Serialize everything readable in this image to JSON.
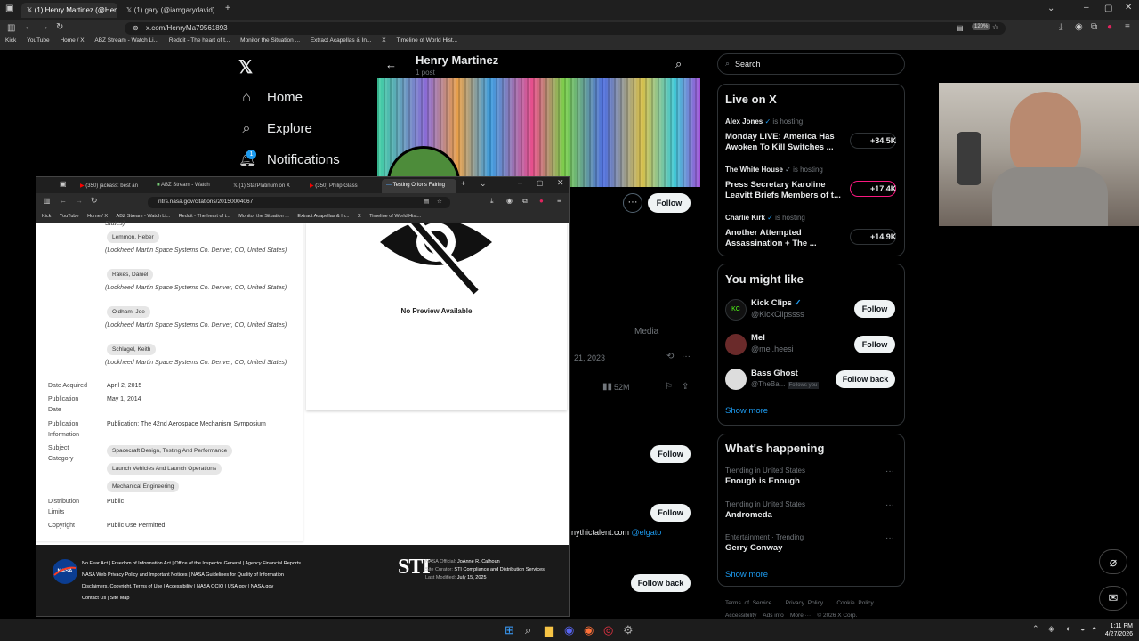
{
  "outer_tabs": [
    {
      "label": "(1) Henry Martinez (@HenryMa",
      "active": true
    },
    {
      "label": "(1) gary (@iamgarydavid) / X",
      "active": false
    }
  ],
  "outer_url": "x.com/HenryMa79561893",
  "outer_zoom": "120%",
  "outer_bookmarks": [
    "Kick",
    "YouTube",
    "Home / X",
    "ABZ Stream - Watch Li...",
    "Reddit - The heart of t...",
    "Monitor the Situation ...",
    "Extract Acapellas & In...",
    "X",
    "Timeline of World Hist..."
  ],
  "nav": {
    "home": "Home",
    "explore": "Explore",
    "notifications": "Notifications",
    "notif_badge": "1"
  },
  "profile": {
    "name": "Henry Martinez",
    "posts": "1 post",
    "follow": "Follow",
    "media_tab": "Media",
    "post_date": "21, 2023",
    "views": "52M",
    "follow2": "Follow",
    "follow3": "Follow",
    "follow_back": "Follow back",
    "link_text": "nythictalent.com",
    "mention": "@elgato"
  },
  "search": {
    "placeholder": "Search"
  },
  "live": {
    "title": "Live on X",
    "items": [
      {
        "host": "Alex Jones",
        "suffix": "is hosting",
        "title": "Monday LIVE: America Has Awoken To Kill Switches ...",
        "count": "+34.5K",
        "pink": false
      },
      {
        "host": "The White House",
        "suffix": "is hosting",
        "title": "Press Secretary Karoline Leavitt Briefs Members of t...",
        "count": "+17.4K",
        "pink": true
      },
      {
        "host": "Charlie Kirk",
        "suffix": "is hosting",
        "title": "Another Attempted Assassination + The ...",
        "count": "+14.9K",
        "pink": false
      }
    ]
  },
  "might_like": {
    "title": "You might like",
    "items": [
      {
        "name": "Kick Clips",
        "handle": "@KickClipssss",
        "btn": "Follow",
        "follows_you": ""
      },
      {
        "name": "Mel",
        "handle": "@mel.heesi",
        "btn": "Follow",
        "follows_you": ""
      },
      {
        "name": "Bass Ghost",
        "handle": "@TheBa...",
        "btn": "Follow back",
        "follows_you": "Follows you"
      }
    ],
    "show_more": "Show more"
  },
  "happening": {
    "title": "What's happening",
    "items": [
      {
        "meta": "Trending in United States",
        "name": "Enough is Enough"
      },
      {
        "meta": "Trending in United States",
        "name": "Andromeda"
      },
      {
        "meta": "Entertainment · Trending",
        "name": "Gerry Conway"
      }
    ],
    "show_more": "Show more"
  },
  "x_footer": {
    "row1": [
      "Terms of Service",
      "Privacy Policy",
      "Cookie Policy"
    ],
    "row2": [
      "Accessibility",
      "Ads info",
      "More ···",
      "© 2026 X Corp."
    ]
  },
  "popup": {
    "tabs": [
      {
        "label": "(350) jackass: best an",
        "active": false
      },
      {
        "label": "ABZ Stream - Watch",
        "active": false
      },
      {
        "label": "(1) StarPlatinum on X",
        "active": false
      },
      {
        "label": "(350) Philip Glass",
        "active": false
      },
      {
        "label": "Testing Orions Fairing",
        "active": true
      }
    ],
    "url": "ntrs.nasa.gov/citations/20150004067",
    "bookmarks": [
      "Kick",
      "YouTube",
      "Home / X",
      "ABZ Stream - Watch Li...",
      "Reddit - The heart of t...",
      "Monitor the Situation ...",
      "Extract Acapellas & In...",
      "X",
      "Timeline of World Hist..."
    ],
    "states_top": "States)",
    "authors": [
      {
        "name": "Lemmon, Heber",
        "aff": "(Lockheed Martin Space Systems Co. Denver, CO, United States)"
      },
      {
        "name": "Rakes, Daniel",
        "aff": "(Lockheed Martin Space Systems Co. Denver, CO, United States)"
      },
      {
        "name": "Oldham, Joe",
        "aff": "(Lockheed Martin Space Systems Co. Denver, CO, United States)"
      },
      {
        "name": "Schlagel, Keith",
        "aff": "(Lockheed Martin Space Systems Co. Denver, CO, United States)"
      }
    ],
    "date_acquired_label": "Date Acquired",
    "date_acquired": "April 2, 2015",
    "pub_date_label": "Publication Date",
    "pub_date": "May 1, 2014",
    "pub_info_label": "Publication Information",
    "pub_info_prefix": "Publication:",
    "pub_info": "The 42nd Aerospace Mechanism Symposium",
    "subject_label": "Subject Category",
    "subjects": [
      "Spacecraft Design, Testing And Performance",
      "Launch Vehicles And Launch Operations",
      "Mechanical Engineering"
    ],
    "dist_label": "Distribution Limits",
    "dist": "Public",
    "copyright_label": "Copyright",
    "copyright": "Public Use Permitted.",
    "no_preview": "No Preview Available",
    "footer_links": [
      "No Fear Act | Freedom of Information Act | Office of the Inspector General | Agency Financial Reports",
      "NASA Web Privacy Policy and Important Notices | NASA Guidelines for Quality of Information",
      "Disclaimers, Copyright, Terms of Use | Accessibility | NASA OCIO | USA.gov | NASA.gov",
      "Contact Us | Site Map"
    ],
    "footer_logo": "STI",
    "nasa_official_label": "NASA Official:",
    "nasa_official": "JoAnne R. Calhoun",
    "curator_label": "Site Curator:",
    "curator": "STI Compliance and Distribution Services",
    "modified_label": "Last Modified:",
    "modified": "July 15, 2025"
  },
  "clock": {
    "time": "1:11 PM",
    "date": "4/27/2026"
  },
  "colors": {
    "accent": "#1d9bf0",
    "pink": "#f91880",
    "nasa_footer": "#1a1a1a"
  }
}
